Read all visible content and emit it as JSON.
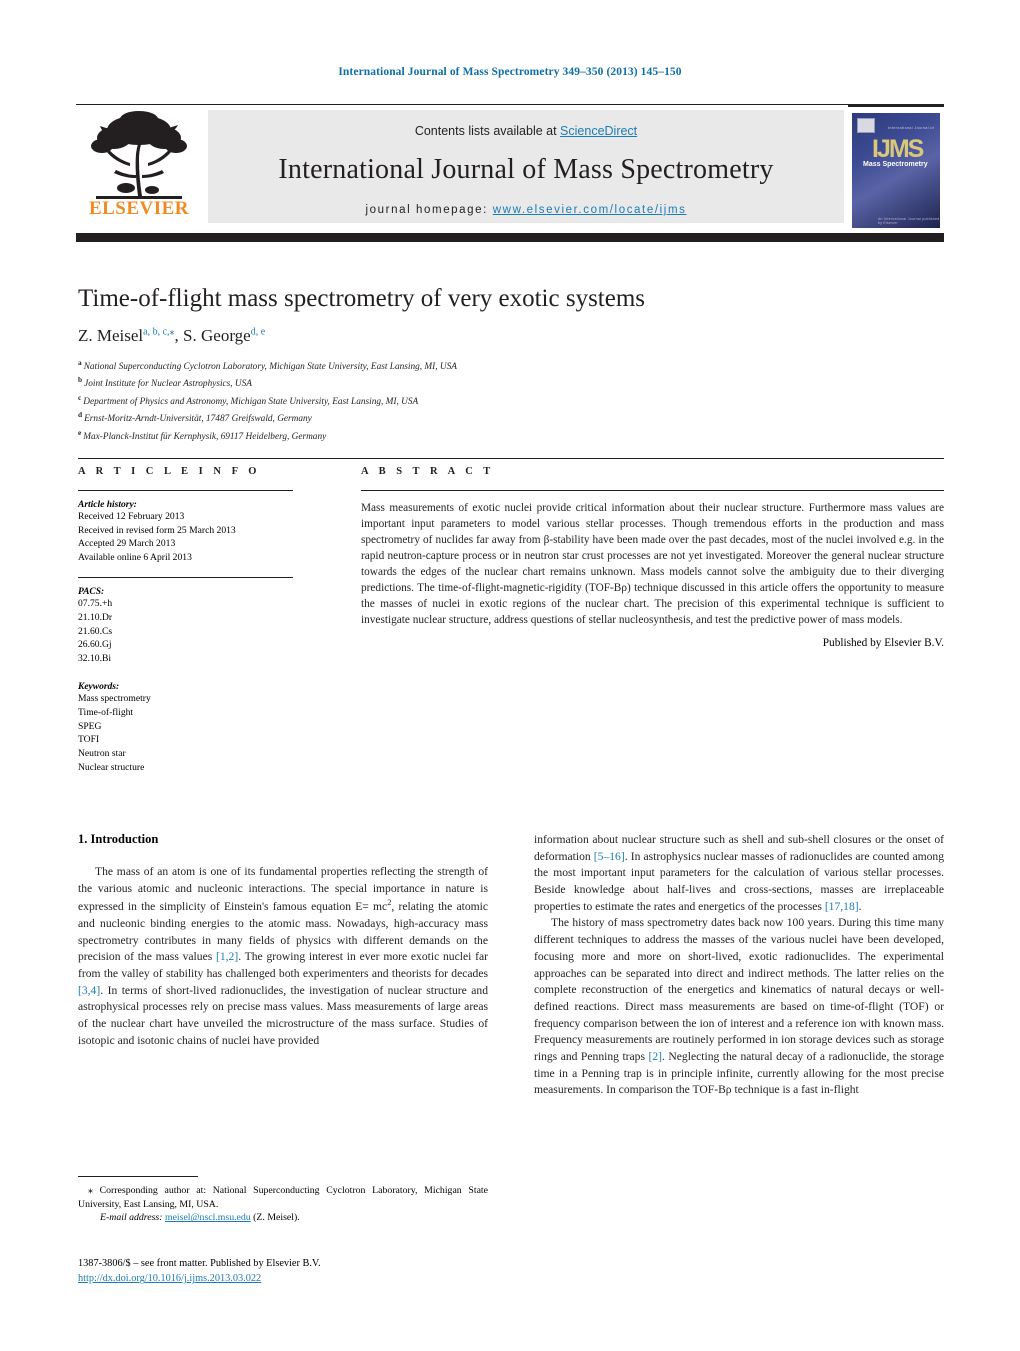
{
  "running_head": "International Journal of Mass Spectrometry 349–350 (2013) 145–150",
  "masthead": {
    "publisher_name": "ELSEVIER",
    "contents_prefix": "Contents lists available at ",
    "contents_link": "ScienceDirect",
    "journal_title": "International Journal of Mass Spectrometry",
    "homepage_prefix": "journal homepage:",
    "homepage_url": "www.elsevier.com/locate/ijms",
    "cover": {
      "acronym": "IJMS",
      "subtitle": "Mass Spectrometry",
      "top_text": "International Journal of",
      "bottom_text": "An International Journal published by Elsevier"
    }
  },
  "article": {
    "title": "Time-of-flight mass spectrometry of very exotic systems",
    "authors": [
      {
        "name": "Z. Meisel",
        "marks": "a, b, c,⁎"
      },
      {
        "name": "S. George",
        "marks": "d, e"
      }
    ],
    "affiliations": [
      {
        "mark": "a",
        "text": "National Superconducting Cyclotron Laboratory, Michigan State University, East Lansing, MI, USA"
      },
      {
        "mark": "b",
        "text": "Joint Institute for Nuclear Astrophysics, USA"
      },
      {
        "mark": "c",
        "text": "Department of Physics and Astronomy, Michigan State University, East Lansing, MI, USA"
      },
      {
        "mark": "d",
        "text": "Ernst-Moritz-Arndt-Universität, 17487 Greifswald, Germany"
      },
      {
        "mark": "e",
        "text": "Max-Planck-Institut für Kernphysik, 69117 Heidelberg, Germany"
      }
    ]
  },
  "article_info": {
    "heading": "A R T I C L E    I N F O",
    "history_label": "Article history:",
    "history": [
      "Received 12 February 2013",
      "Received in revised form 25 March 2013",
      "Accepted 29 March 2013",
      "Available online 6 April 2013"
    ],
    "pacs_label": "PACS:",
    "pacs": [
      "07.75.+h",
      "21.10.Dr",
      "21.60.Cs",
      "26.60.Gj",
      "32.10.Bi"
    ],
    "keywords_label": "Keywords:",
    "keywords": [
      "Mass spectrometry",
      "Time-of-flight",
      "SPEG",
      "TOFI",
      "Neutron star",
      "Nuclear structure"
    ]
  },
  "abstract": {
    "heading": "A B S T R A C T",
    "text": "Mass measurements of exotic nuclei provide critical information about their nuclear structure. Furthermore mass values are important input parameters to model various stellar processes. Though tremendous efforts in the production and mass spectrometry of nuclides far away from β-stability have been made over the past decades, most of the nuclei involved e.g. in the rapid neutron-capture process or in neutron star crust processes are not yet investigated. Moreover the general nuclear structure towards the edges of the nuclear chart remains unknown. Mass models cannot solve the ambiguity due to their diverging predictions. The time-of-flight-magnetic-rigidity (TOF-Bρ) technique discussed in this article offers the opportunity to measure the masses of nuclei in exotic regions of the nuclear chart. The precision of this experimental technique is sufficient to investigate nuclear structure, address questions of stellar nucleosynthesis, and test the predictive power of mass models.",
    "credit": "Published by Elsevier B.V."
  },
  "body": {
    "section_number_title": "1.  Introduction",
    "left_paragraph_1": "The mass of an atom is one of its fundamental properties reflecting the strength of the various atomic and nucleonic interactions. The special importance in nature is expressed in the simplicity of Einstein's famous equation E= mc2, relating the atomic and nucleonic binding energies to the atomic mass. Nowadays, high-accuracy mass spectrometry contributes in many fields of physics with different demands on the precision of the mass values [1,2]. The growing interest in ever more exotic nuclei far from the valley of stability has challenged both experimenters and theorists for decades [3,4]. In terms of short-lived radionuclides, the investigation of nuclear structure and astrophysical processes rely on precise mass values. Mass measurements of large areas of the nuclear chart have unveiled the microstructure of the mass surface. Studies of isotopic and isotonic chains of nuclei have provided",
    "right_paragraph_1": "information about nuclear structure such as shell and sub-shell closures or the onset of deformation [5–16]. In astrophysics nuclear masses of radionuclides are counted among the most important input parameters for the calculation of various stellar processes. Beside knowledge about half-lives and cross-sections, masses are irreplaceable properties to estimate the rates and energetics of the processes [17,18].",
    "right_paragraph_2": "The history of mass spectrometry dates back now 100 years. During this time many different techniques to address the masses of the various nuclei have been developed, focusing more and more on short-lived, exotic radionuclides. The experimental approaches can be separated into direct and indirect methods. The latter relies on the complete reconstruction of the energetics and kinematics of natural decays or well-defined reactions. Direct mass measurements are based on time-of-flight (TOF) or frequency comparison between the ion of interest and a reference ion with known mass. Frequency measurements are routinely performed in ion storage devices such as storage rings and Penning traps [2]. Neglecting the natural decay of a radionuclide, the storage time in a Penning trap is in principle infinite, currently allowing for the most precise measurements. In comparison the TOF-Bρ technique is a fast in-flight"
  },
  "footnotes": {
    "corresponding": "⁎ Corresponding author at: National Superconducting Cyclotron Laboratory, Michigan State University, East Lansing, MI, USA.",
    "email_label": "E-mail address:",
    "email_address": "meisel@nscl.msu.edu",
    "email_owner": "(Z. Meisel)."
  },
  "colophon": {
    "issn_line": "1387-3806/$ – see front matter. Published by Elsevier B.V.",
    "doi": "http://dx.doi.org/10.1016/j.ijms.2013.03.022"
  },
  "colors": {
    "link_blue": "#1b7db5",
    "elsevier_orange": "#f18a21",
    "band_gray": "#e9e9e9",
    "rule_black": "#231f20"
  }
}
